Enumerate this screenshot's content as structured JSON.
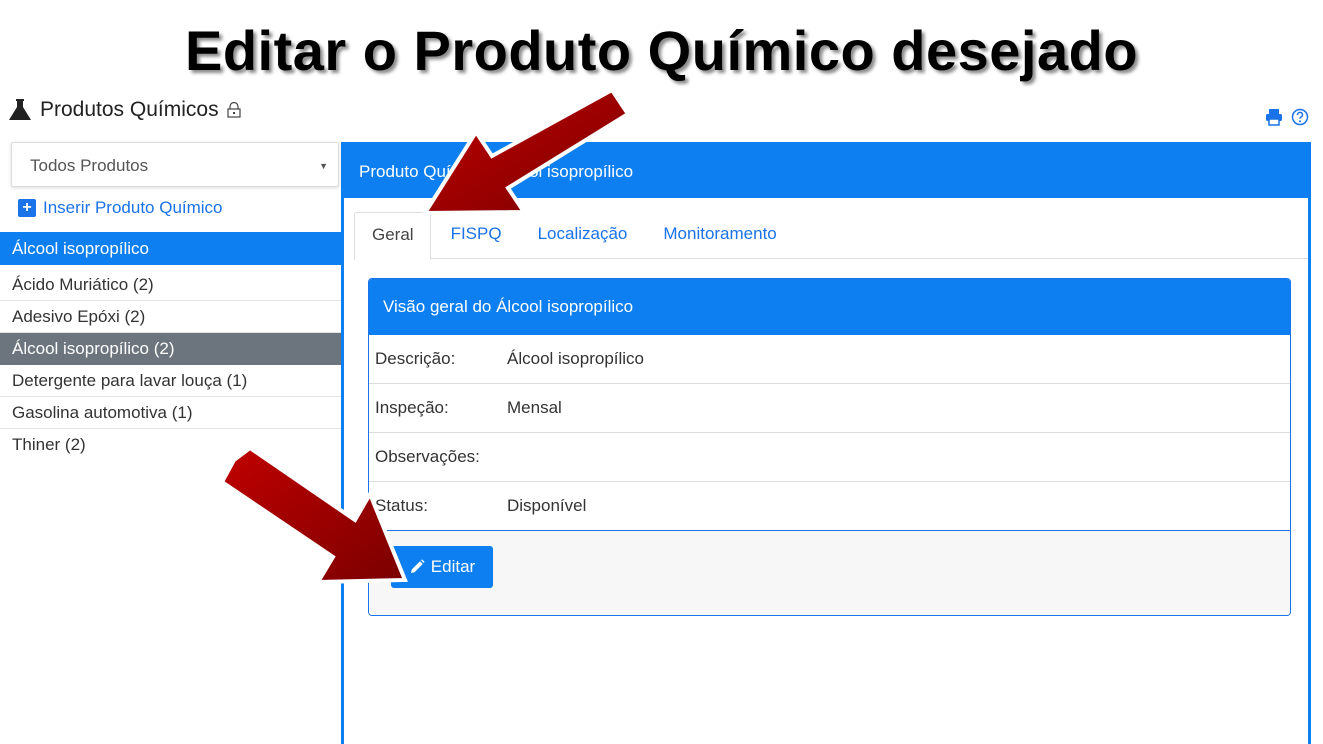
{
  "slide": {
    "title": "Editar o Produto Químico desejado"
  },
  "header": {
    "title": "Produtos Químicos"
  },
  "sidebar": {
    "filter_value": "Todos Produtos",
    "insert_label": "Inserir Produto Químico",
    "selected_name": "Álcool isopropílico",
    "items": [
      {
        "label": "Ácido Muriático (2)"
      },
      {
        "label": "Adesivo Epóxi (2)"
      },
      {
        "label": "Álcool isopropílico (2)"
      },
      {
        "label": "Detergente para lavar louça (1)"
      },
      {
        "label": "Gasolina automotiva (1)"
      },
      {
        "label": "Thiner (2)"
      }
    ]
  },
  "panel": {
    "title": "Produto Químico: Álcool isopropílico",
    "tabs": [
      {
        "label": "Geral"
      },
      {
        "label": "FISPQ"
      },
      {
        "label": "Localização"
      },
      {
        "label": "Monitoramento"
      }
    ],
    "card": {
      "title": "Visão geral do Álcool isopropílico",
      "rows": [
        {
          "label": "Descrição:",
          "value": "Álcool isopropílico"
        },
        {
          "label": "Inspeção:",
          "value": "Mensal"
        },
        {
          "label": "Observações:",
          "value": ""
        },
        {
          "label": "Status:",
          "value": "Disponível"
        }
      ],
      "edit_label": "Editar"
    }
  },
  "colors": {
    "primary": "#0d7ff0",
    "active_item": "#6c757d",
    "arrow": "#a00000"
  },
  "icons": [
    "flask-icon",
    "lock-icon",
    "print-icon",
    "help-icon",
    "plus-icon",
    "pencil-icon",
    "dropdown-caret-icon"
  ]
}
